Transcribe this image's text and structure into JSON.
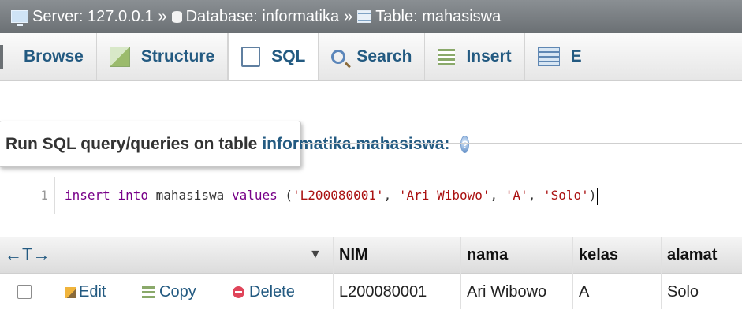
{
  "breadcrumb": {
    "server_label": "Server:",
    "server_value": "127.0.0.1",
    "database_label": "Database:",
    "database_value": "informatika",
    "table_label": "Table:",
    "table_value": "mahasiswa",
    "separator": "»"
  },
  "tabs": [
    {
      "label": "Browse"
    },
    {
      "label": "Structure"
    },
    {
      "label": "SQL"
    },
    {
      "label": "Search"
    },
    {
      "label": "Insert"
    },
    {
      "label": "E"
    }
  ],
  "legend": {
    "text": "Run SQL query/queries on table",
    "table": "informatika.mahasiswa:"
  },
  "editor": {
    "line_number": "1",
    "tokens": {
      "k1": "insert",
      "k2": "into",
      "t": "mahasiswa",
      "k3": "values",
      "p1": "(",
      "s1": "'L200080001'",
      "c1": ",",
      "s2": "'Ari Wibowo'",
      "c2": ",",
      "s3": "'A'",
      "c3": ",",
      "s4": "'Solo'",
      "p2": ")"
    }
  },
  "results": {
    "arrows": "←T→",
    "sort_indicator": "▼",
    "columns": [
      "NIM",
      "nama",
      "kelas",
      "alamat"
    ],
    "actions": {
      "edit": "Edit",
      "copy": "Copy",
      "delete": "Delete"
    },
    "row": [
      "L200080001",
      "Ari Wibowo",
      "A",
      "Solo"
    ]
  },
  "colors": {
    "link": "#235a81",
    "breadcrumb_bg": "#6b7074",
    "delete_icon": "#e0455a"
  }
}
